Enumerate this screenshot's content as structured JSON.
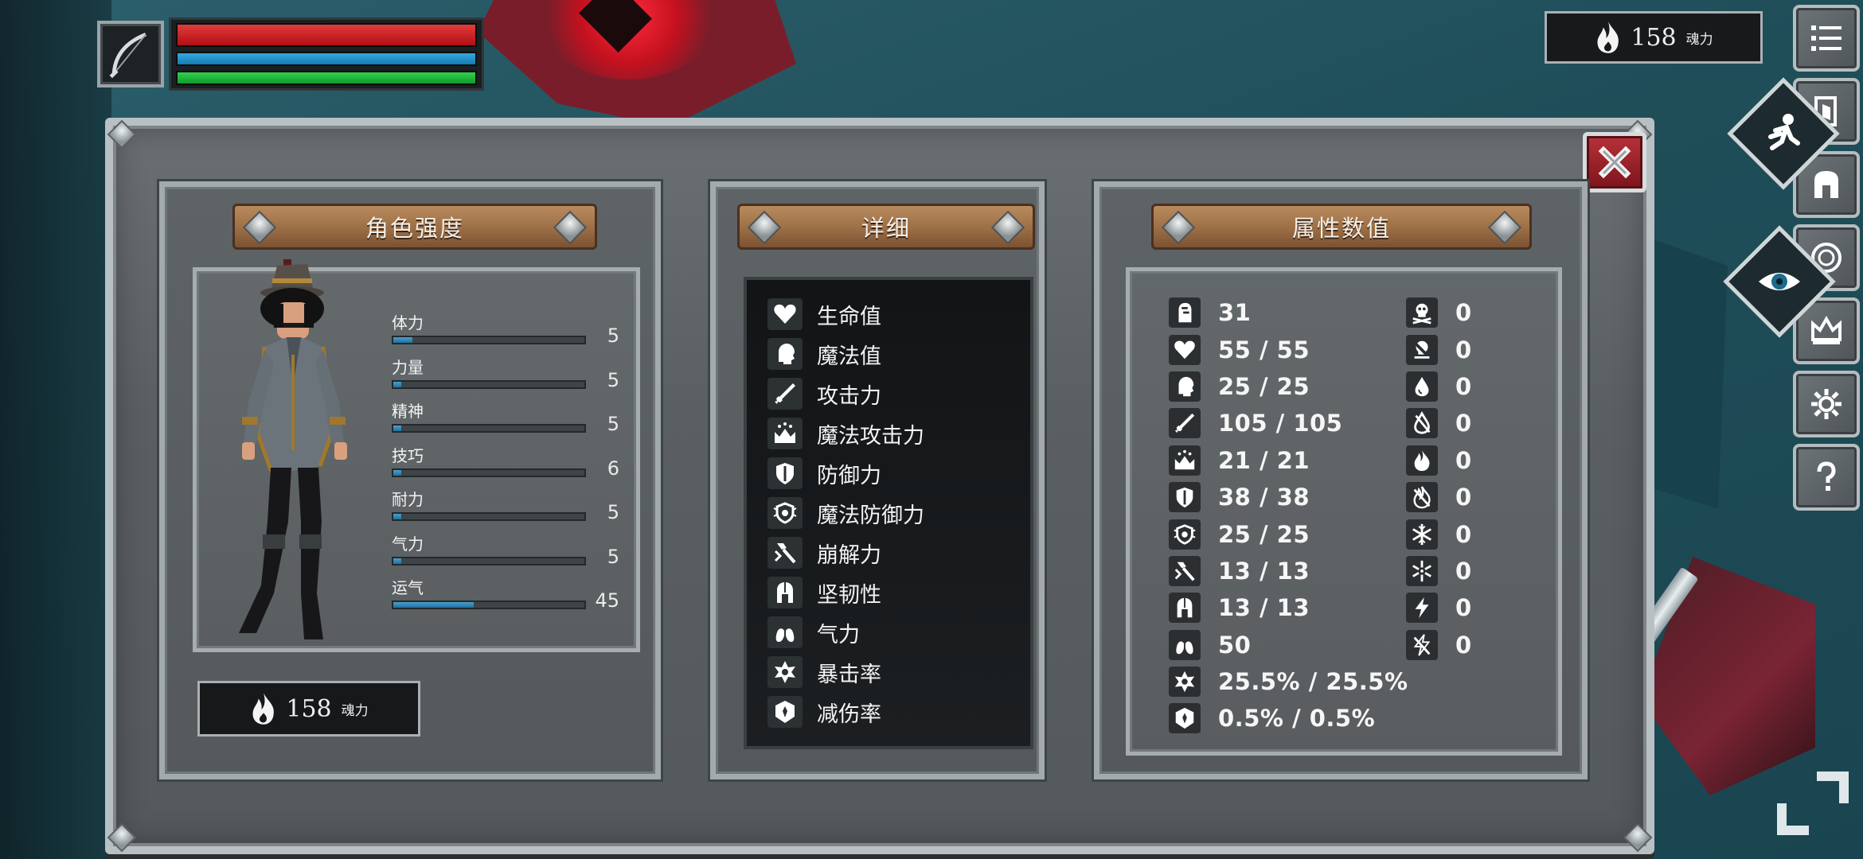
{
  "hud": {
    "soul_count": "158",
    "soul_unit": "魂力"
  },
  "character_panel": {
    "title": "角色强度",
    "stats": [
      {
        "name": "体力",
        "value": "5",
        "fill": 0.1
      },
      {
        "name": "力量",
        "value": "5",
        "fill": 0.04
      },
      {
        "name": "精神",
        "value": "5",
        "fill": 0.04
      },
      {
        "name": "技巧",
        "value": "6",
        "fill": 0.04
      },
      {
        "name": "耐力",
        "value": "5",
        "fill": 0.04
      },
      {
        "name": "气力",
        "value": "5",
        "fill": 0.04
      },
      {
        "name": "运气",
        "value": "45",
        "fill": 0.42
      }
    ],
    "soul_count": "158",
    "soul_unit": "魂力"
  },
  "detail_panel": {
    "title": "详细",
    "items": [
      {
        "label": "生命值",
        "icon": "heart-icon"
      },
      {
        "label": "魔法值",
        "icon": "head-icon"
      },
      {
        "label": "攻击力",
        "icon": "sword-icon"
      },
      {
        "label": "魔法攻击力",
        "icon": "magic-crown-icon"
      },
      {
        "label": "防御力",
        "icon": "shield-icon"
      },
      {
        "label": "魔法防御力",
        "icon": "magic-shield-icon"
      },
      {
        "label": "崩解力",
        "icon": "axe-icon"
      },
      {
        "label": "坚韧性",
        "icon": "helmet-icon"
      },
      {
        "label": "气力",
        "icon": "lungs-icon"
      },
      {
        "label": "暴击率",
        "icon": "star-icon"
      },
      {
        "label": "减伤率",
        "icon": "badge-icon"
      }
    ]
  },
  "attr_panel": {
    "title": "属性数值",
    "left": [
      {
        "icon": "helmet-side-icon",
        "value": "31"
      },
      {
        "icon": "heart-icon",
        "value": "55 / 55"
      },
      {
        "icon": "head-icon",
        "value": "25 / 25"
      },
      {
        "icon": "sword-icon",
        "value": "105 / 105"
      },
      {
        "icon": "magic-crown-icon",
        "value": "21 / 21"
      },
      {
        "icon": "shield-icon",
        "value": "38 / 38"
      },
      {
        "icon": "magic-shield-icon",
        "value": "25 / 25"
      },
      {
        "icon": "axe-icon",
        "value": "13 / 13"
      },
      {
        "icon": "helmet-icon",
        "value": "13 / 13"
      },
      {
        "icon": "lungs-icon",
        "value": "50"
      },
      {
        "icon": "star-icon",
        "value": "25.5% / 25.5%"
      },
      {
        "icon": "badge-icon",
        "value": "0.5% / 0.5%"
      }
    ],
    "right": [
      {
        "icon": "skull-icon",
        "value": "0"
      },
      {
        "icon": "skull-strike-icon",
        "value": "0"
      },
      {
        "icon": "drop-icon",
        "value": "0"
      },
      {
        "icon": "drop-strike-icon",
        "value": "0"
      },
      {
        "icon": "fire-icon",
        "value": "0"
      },
      {
        "icon": "fire-strike-icon",
        "value": "0"
      },
      {
        "icon": "frost-icon",
        "value": "0"
      },
      {
        "icon": "frost-strike-icon",
        "value": "0"
      },
      {
        "icon": "lightning-icon",
        "value": "0"
      },
      {
        "icon": "lightning-strike-icon",
        "value": "0"
      }
    ]
  },
  "colors": {
    "hp": "#c8141c",
    "mp": "#1e90c8",
    "sp": "#1fb83a",
    "stat_fill": "#2f86b8",
    "close_button": "#a0242c"
  }
}
